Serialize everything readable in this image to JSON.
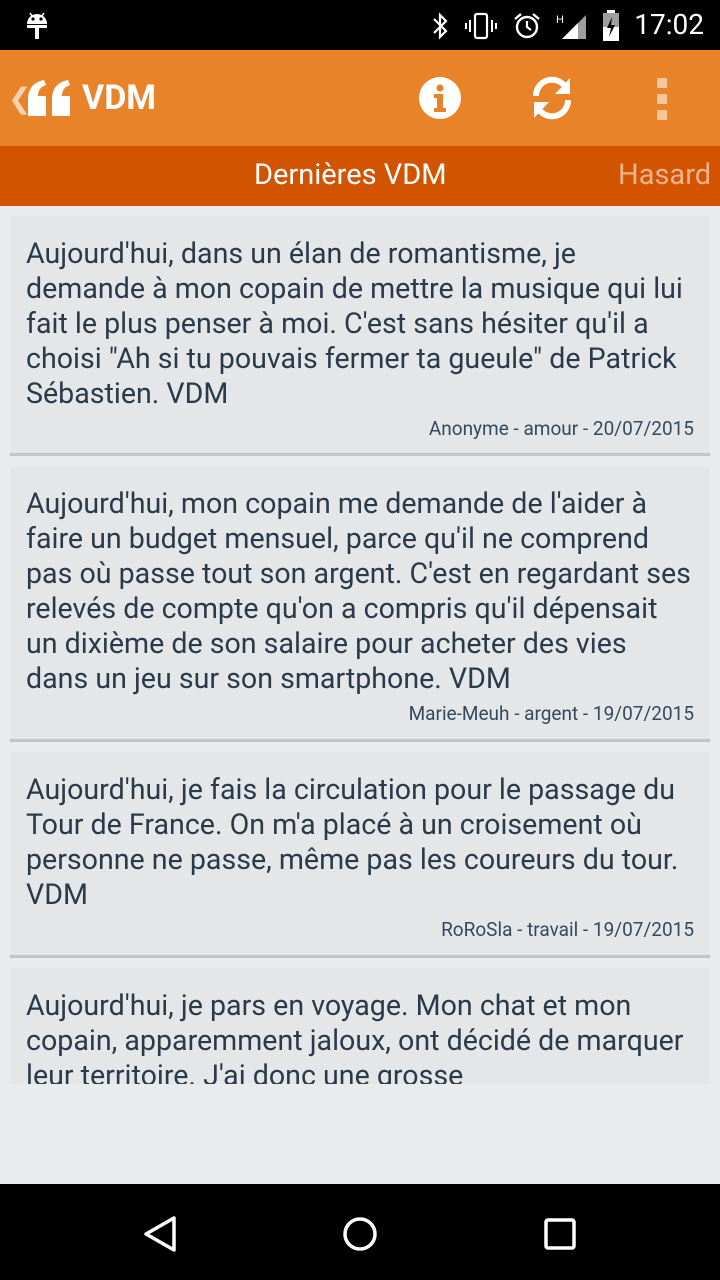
{
  "status_bar": {
    "time": "17:02",
    "icons": [
      "android-icon",
      "bluetooth-icon",
      "vibrate-icon",
      "alarm-icon",
      "signal-h-icon",
      "battery-icon"
    ]
  },
  "app_bar": {
    "title": "VDM",
    "actions": [
      "info-icon",
      "refresh-icon",
      "overflow-menu-icon"
    ]
  },
  "tabs": {
    "active": "Dernières VDM",
    "next": "Hasard"
  },
  "posts": [
    {
      "text": "Aujourd'hui, dans un élan de romantisme, je demande à mon copain de mettre la musique qui lui fait le plus penser à moi. C'est sans hésiter qu'il a choisi \"Ah si tu pouvais fermer ta gueule\" de Patrick Sébastien. VDM",
      "meta": "Anonyme - amour - 20/07/2015"
    },
    {
      "text": "Aujourd'hui, mon copain me demande de l'aider à faire un budget mensuel, parce qu'il ne comprend pas où passe tout son argent. C'est en regardant ses relevés de compte qu'on a compris qu'il dépensait un dixième de son salaire pour acheter des vies dans un jeu sur son smartphone. VDM",
      "meta": "Marie-Meuh - argent - 19/07/2015"
    },
    {
      "text": "Aujourd'hui, je fais la circulation pour le passage du Tour de France. On m'a placé à un croisement où personne ne passe, même pas les coureurs du tour. VDM",
      "meta": "RoRoSla - travail - 19/07/2015"
    },
    {
      "text": "Aujourd'hui, je pars en voyage. Mon chat et mon copain, apparemment jaloux, ont décidé de marquer leur territoire. J'ai donc une grosse",
      "meta": ""
    }
  ],
  "colors": {
    "app_bar": "#e8832a",
    "tab_bar": "#d35400",
    "background": "#e9ebec",
    "card": "#e4e6e7",
    "text": "#2b3a4a"
  }
}
